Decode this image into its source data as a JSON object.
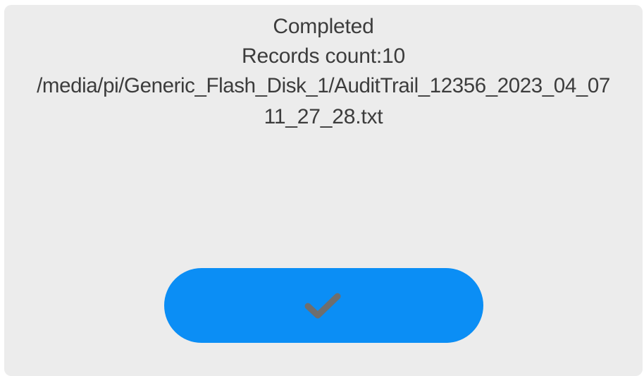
{
  "dialog": {
    "lines": [
      "Completed",
      "Records count:10",
      "/media/pi/Generic_Flash_Disk_1/AuditTrail_12356_2023_04_07",
      "11_27_28.txt"
    ],
    "confirm_icon": "checkmark-icon"
  },
  "colors": {
    "background": "#ececec",
    "text": "#3c3c3c",
    "button": "#0b8ef5",
    "icon": "#6e6e6e"
  }
}
